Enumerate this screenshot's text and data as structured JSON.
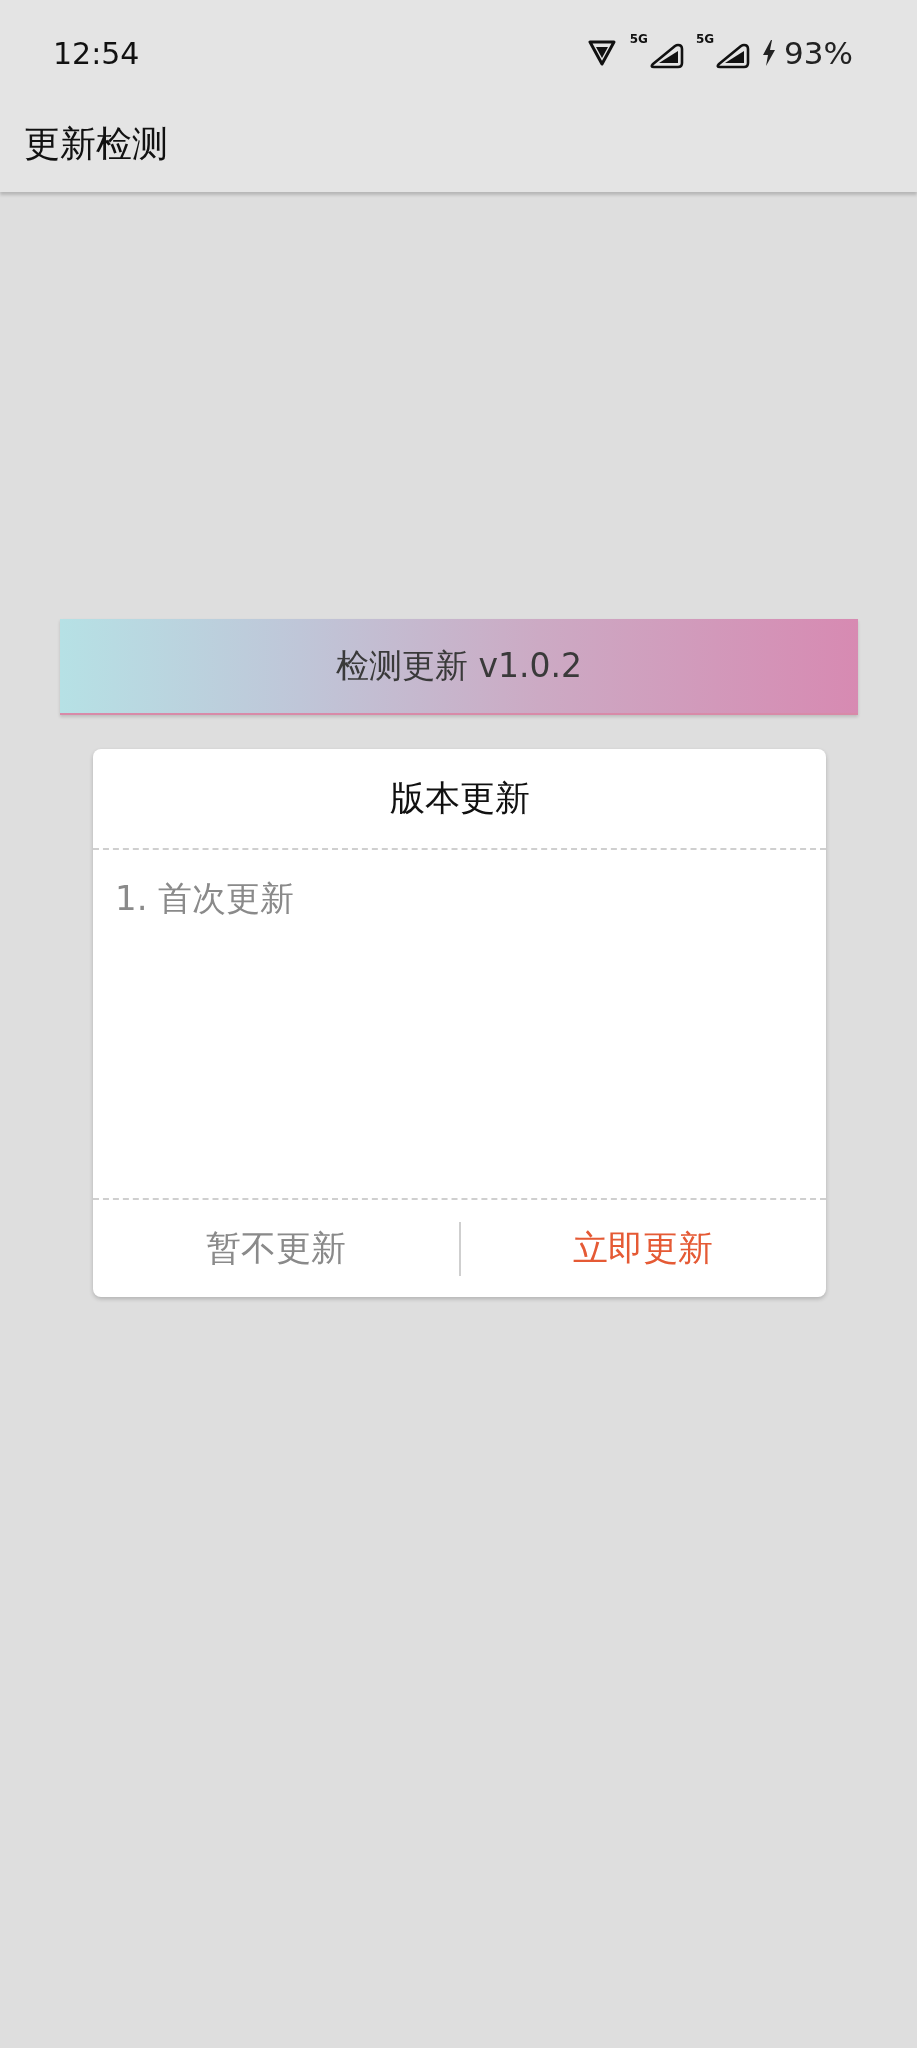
{
  "status_bar": {
    "time": "12:54",
    "signals": [
      {
        "network": "5G"
      },
      {
        "network": "5G"
      }
    ],
    "battery": "93%"
  },
  "app_bar": {
    "title": "更新检测"
  },
  "check_button": {
    "label": "检测更新 v1.0.2"
  },
  "dialog": {
    "title": "版本更新",
    "notes": [
      "1. 首次更新"
    ],
    "buttons": [
      {
        "label": "暂不更新",
        "kind": "secondary"
      },
      {
        "label": "立即更新",
        "kind": "primary"
      }
    ]
  }
}
